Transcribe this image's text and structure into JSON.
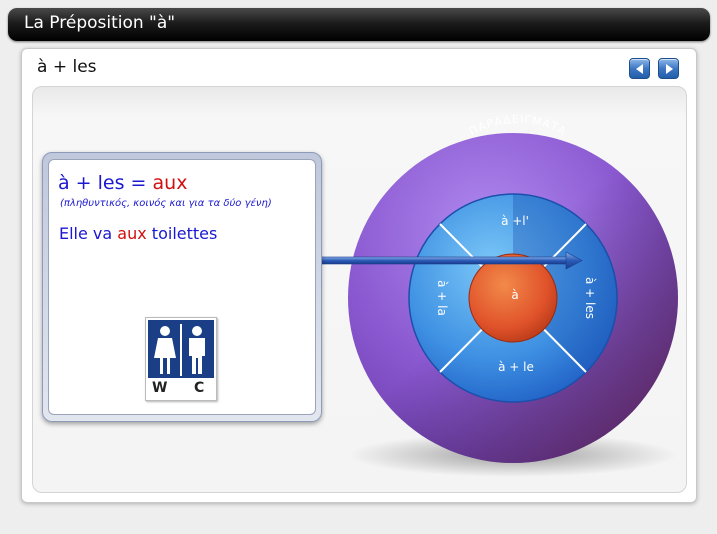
{
  "window": {
    "title": "La Préposition \"à\""
  },
  "slide": {
    "title": "à + les"
  },
  "nav": {
    "prev_icon": "triangle-left-icon",
    "next_icon": "triangle-right-icon"
  },
  "card": {
    "heading_prefix": "à + les = ",
    "heading_highlight": "aux",
    "subtitle": "(πληθυντικός, κοινός και για τα δύο γένη)",
    "example_before": "Elle va ",
    "example_highlight": "aux",
    "example_after": " toilettes",
    "image_letters": [
      "W",
      "C"
    ]
  },
  "diagram": {
    "outer_label": "ΠΑΡΑΔΕΙΓΜΑΤΑ",
    "center_label": "à",
    "segments": {
      "top": "à +l'",
      "left": "à + la",
      "bottom": "à + le",
      "right": "à + les"
    }
  },
  "colors": {
    "blue_text": "#1a18d0",
    "red_text": "#d20f0f",
    "outer_ring": "#8f5fd0",
    "middle_ring": "#3a8be0",
    "center": "#e0522a"
  }
}
